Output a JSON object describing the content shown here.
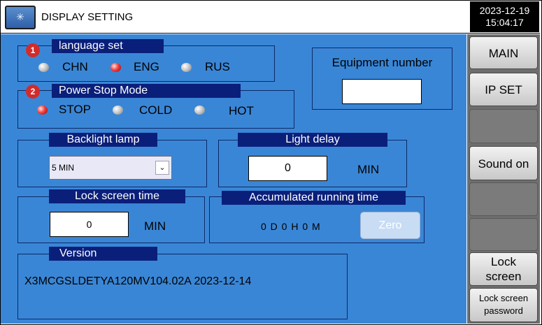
{
  "header": {
    "title": "DISPLAY SETTING",
    "date": "2023-12-19",
    "time": "15:04:17",
    "logo_icon": "snowflake-icon"
  },
  "language": {
    "badge": "1",
    "title": "language set",
    "options": [
      {
        "label": "CHN",
        "active": false
      },
      {
        "label": "ENG",
        "active": true
      },
      {
        "label": "RUS",
        "active": false
      }
    ]
  },
  "equipment": {
    "title": "Equipment number",
    "value": ""
  },
  "power_stop": {
    "badge": "2",
    "title": "Power Stop Mode",
    "options": [
      {
        "label": "STOP",
        "active": true
      },
      {
        "label": "COLD",
        "active": false
      },
      {
        "label": "HOT",
        "active": false
      }
    ]
  },
  "backlight": {
    "title": "Backlight lamp",
    "selected": "5 MIN"
  },
  "light_delay": {
    "title": "Light delay",
    "value": "0",
    "unit": "MIN"
  },
  "lock_time": {
    "title": "Lock screen time",
    "value": "0",
    "unit": "MIN"
  },
  "running_time": {
    "title": "Accumulated running time",
    "value": "0 D 0 H 0 M",
    "zero_label": "Zero"
  },
  "version": {
    "title": "Version",
    "text": "X3MCGSLDETYA120MV104.02A 2023-12-14"
  },
  "sidebar": {
    "main": "MAIN",
    "ip_set": "IP SET",
    "sound": "Sound on",
    "lock_l1": "Lock",
    "lock_l2": "screen",
    "lockpw_l1": "Lock screen",
    "lockpw_l2": "password"
  },
  "colors": {
    "panel": "#3a86d6",
    "header_bar": "#0a1f7a",
    "led_on": "#f04040",
    "led_off": "#c9c9c9",
    "sidebar": "#6e6e6e"
  }
}
